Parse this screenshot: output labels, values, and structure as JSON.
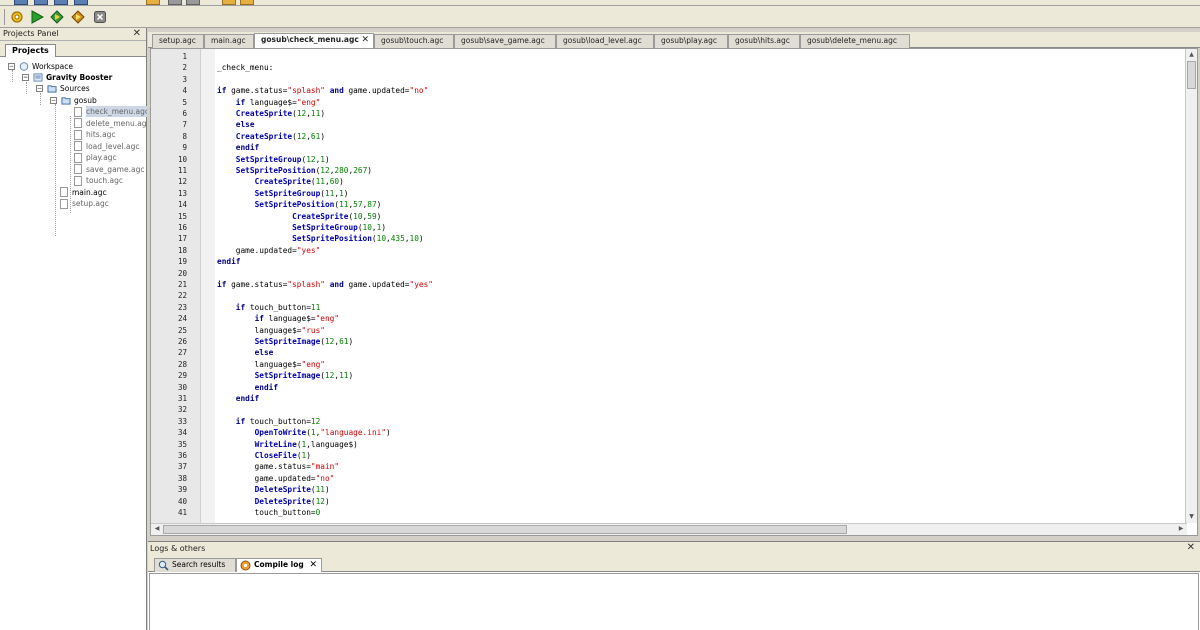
{
  "toolbar": {
    "buttons": [
      {
        "name": "settings-icon",
        "color": "#e0a000"
      },
      {
        "name": "run-icon",
        "color": "#2aa02a"
      },
      {
        "name": "compile-icon",
        "color": "#3a9a3a"
      },
      {
        "name": "broadcast-icon",
        "color": "#d08a20"
      },
      {
        "name": "stop-icon",
        "color": "#707070"
      }
    ]
  },
  "projects_panel": {
    "title": "Projects Panel",
    "close": "✕",
    "tab": "Projects",
    "tree": {
      "workspace": "Workspace",
      "project": "Gravity Booster",
      "sources": "Sources",
      "gosub": "gosub",
      "gosub_files": [
        "check_menu.agc",
        "delete_menu.agc",
        "hits.agc",
        "load_level.agc",
        "play.agc",
        "save_game.agc",
        "touch.agc"
      ],
      "root_files": [
        "main.agc",
        "setup.agc"
      ]
    }
  },
  "editor_tabs": [
    {
      "label": "setup.agc",
      "active": false
    },
    {
      "label": "main.agc",
      "active": false
    },
    {
      "label": "gosub\\check_menu.agc",
      "active": true
    },
    {
      "label": "gosub\\touch.agc",
      "active": false
    },
    {
      "label": "gosub\\save_game.agc",
      "active": false
    },
    {
      "label": "gosub\\load_level.agc",
      "active": false
    },
    {
      "label": "gosub\\play.agc",
      "active": false
    },
    {
      "label": "gosub\\hits.agc",
      "active": false
    },
    {
      "label": "gosub\\delete_menu.agc",
      "active": false
    }
  ],
  "editor_tab_close": "✕",
  "code_lines": [
    {
      "n": "1",
      "t": ""
    },
    {
      "n": "2",
      "t": "_check_menu:"
    },
    {
      "n": "3",
      "t": ""
    },
    {
      "n": "4",
      "t": "if game.status=\"splash\" and game.updated=\"no\""
    },
    {
      "n": "5",
      "t": "    if language$=\"eng\""
    },
    {
      "n": "6",
      "t": "    CreateSprite(12,11)"
    },
    {
      "n": "7",
      "t": "    else"
    },
    {
      "n": "8",
      "t": "    CreateSprite(12,61)"
    },
    {
      "n": "9",
      "t": "    endif"
    },
    {
      "n": "10",
      "t": "    SetSpriteGroup(12,1)"
    },
    {
      "n": "11",
      "t": "    SetSpritePosition(12,280,267)"
    },
    {
      "n": "12",
      "t": "        CreateSprite(11,60)"
    },
    {
      "n": "13",
      "t": "        SetSpriteGroup(11,1)"
    },
    {
      "n": "14",
      "t": "        SetSpritePosition(11,57,87)"
    },
    {
      "n": "15",
      "t": "                CreateSprite(10,59)"
    },
    {
      "n": "16",
      "t": "                SetSpriteGroup(10,1)"
    },
    {
      "n": "17",
      "t": "                SetSpritePosition(10,435,10)"
    },
    {
      "n": "18",
      "t": "    game.updated=\"yes\""
    },
    {
      "n": "19",
      "t": "endif"
    },
    {
      "n": "20",
      "t": ""
    },
    {
      "n": "21",
      "t": "if game.status=\"splash\" and game.updated=\"yes\""
    },
    {
      "n": "22",
      "t": ""
    },
    {
      "n": "23",
      "t": "    if touch_button=11"
    },
    {
      "n": "24",
      "t": "        if language$=\"eng\""
    },
    {
      "n": "25",
      "t": "        language$=\"rus\""
    },
    {
      "n": "26",
      "t": "        SetSpriteImage(12,61)"
    },
    {
      "n": "27",
      "t": "        else"
    },
    {
      "n": "28",
      "t": "        language$=\"eng\""
    },
    {
      "n": "29",
      "t": "        SetSpriteImage(12,11)"
    },
    {
      "n": "30",
      "t": "        endif"
    },
    {
      "n": "31",
      "t": "    endif"
    },
    {
      "n": "32",
      "t": ""
    },
    {
      "n": "33",
      "t": "    if touch_button=12"
    },
    {
      "n": "34",
      "t": "        OpenToWrite(1,\"language.ini\")"
    },
    {
      "n": "35",
      "t": "        WriteLine(1,language$)"
    },
    {
      "n": "36",
      "t": "        CloseFile(1)"
    },
    {
      "n": "37",
      "t": "        game.status=\"main\""
    },
    {
      "n": "38",
      "t": "        game.updated=\"no\""
    },
    {
      "n": "39",
      "t": "        DeleteSprite(11)"
    },
    {
      "n": "40",
      "t": "        DeleteSprite(12)"
    },
    {
      "n": "41",
      "t": "        touch_button=0"
    }
  ],
  "logs_panel": {
    "title": "Logs & others",
    "close": "✕",
    "tabs": [
      {
        "label": "Search results",
        "icon": "search-icon",
        "active": false
      },
      {
        "label": "Compile log",
        "icon": "compile-log-icon",
        "active": true
      }
    ],
    "tab_close": "✕"
  },
  "colors": {
    "keyword": "#00008b",
    "function": "#0000b0",
    "string": "#d00000",
    "number": "#008000"
  }
}
